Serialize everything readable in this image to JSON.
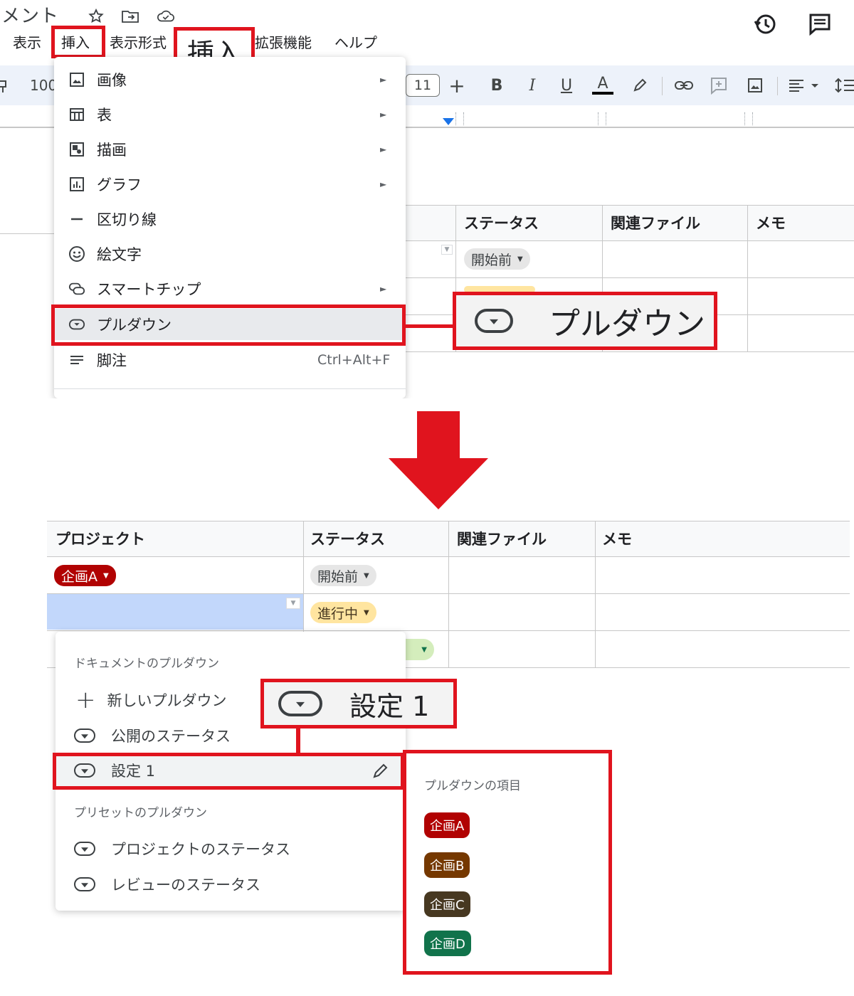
{
  "doc": {
    "title": "メント"
  },
  "menubar": {
    "view": "表示",
    "insert": "挿入",
    "format": "表示形式",
    "extensions": "拡張機能",
    "help": "ヘルプ"
  },
  "callout_insert": "挿入",
  "toolbar": {
    "zoom": "100",
    "font_size": "11",
    "plus": "+",
    "bold": "B",
    "italic": "I",
    "underline": "U",
    "text_color": "A"
  },
  "insert_menu": {
    "items": [
      {
        "label": "画像",
        "icon": "image-icon",
        "submenu": true
      },
      {
        "label": "表",
        "icon": "table-icon",
        "submenu": true
      },
      {
        "label": "描画",
        "icon": "drawing-icon",
        "submenu": true
      },
      {
        "label": "グラフ",
        "icon": "chart-icon",
        "submenu": true
      },
      {
        "label": "区切り線",
        "icon": "horizontal-line-icon",
        "submenu": false
      },
      {
        "label": "絵文字",
        "icon": "emoji-icon",
        "submenu": false
      },
      {
        "label": "スマートチップ",
        "icon": "smart-chip-icon",
        "submenu": true
      },
      {
        "label": "プルダウン",
        "icon": "dropdown-icon",
        "submenu": false
      },
      {
        "label": "脚注",
        "icon": "footnote-icon",
        "submenu": false,
        "shortcut": "Ctrl+Alt+F"
      }
    ]
  },
  "callout_dropdown": "プルダウン",
  "top_table": {
    "headers": [
      "ステータス",
      "関連ファイル",
      "メモ"
    ],
    "status_chip": "開始前"
  },
  "bottom_table": {
    "headers": [
      "プロジェクト",
      "ステータス",
      "関連ファイル",
      "メモ"
    ],
    "project_chip": "企画A",
    "status_chips": [
      "開始前",
      "進行中"
    ]
  },
  "dropdown_panel": {
    "section_document": "ドキュメントのプルダウン",
    "new_dropdown": "新しいプルダウン",
    "public_status": "公開のステータス",
    "setting1": "設定 1",
    "section_preset": "プリセットのプルダウン",
    "presets": [
      "プロジェクトのステータス",
      "レビューのステータス"
    ]
  },
  "callout_setting": "設定 1",
  "items_panel": {
    "title": "プルダウンの項目",
    "items": [
      {
        "label": "企画A",
        "color": "#b10202"
      },
      {
        "label": "企画B",
        "color": "#753800"
      },
      {
        "label": "企画C",
        "color": "#473821"
      },
      {
        "label": "企画D",
        "color": "#11734b"
      }
    ]
  },
  "colors": {
    "accent_red": "#e0141e",
    "selection_blue": "#c2d7fb"
  }
}
